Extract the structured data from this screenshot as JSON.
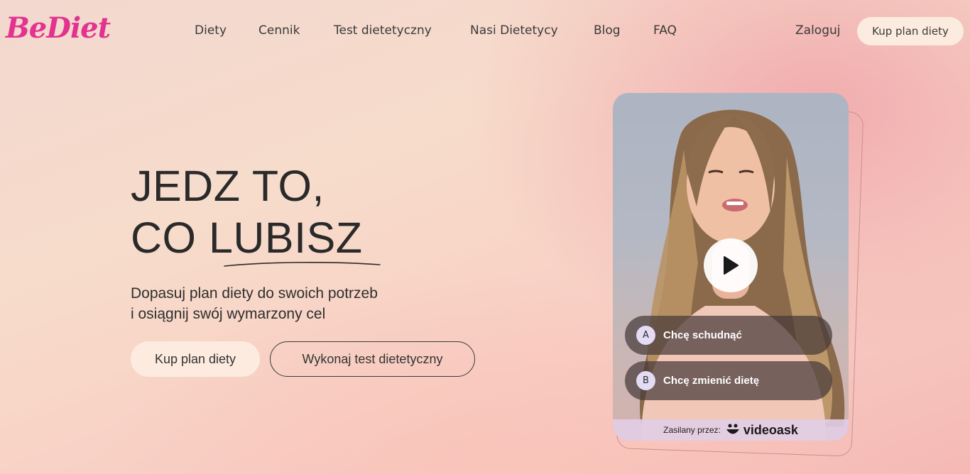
{
  "header": {
    "logo": "BeDiet",
    "nav": [
      "Diety",
      "Cennik",
      "Test dietetyczny",
      "Nasi Dietetycy",
      "Blog",
      "FAQ"
    ],
    "login": "Zaloguj",
    "cta": "Kup plan diety"
  },
  "hero": {
    "title_line1": "JEDZ TO,",
    "title_line2_prefix": "CO ",
    "title_line2_emphasis": "LUBISZ",
    "subtitle_line1": "Dopasuj plan diety do swoich potrzeb",
    "subtitle_line2": "i osiągnij swój wymarzony cel",
    "primary_button": "Kup plan diety",
    "secondary_button": "Wykonaj test dietetyczny"
  },
  "video": {
    "options": [
      {
        "letter": "A",
        "label": "Chcę schudnąć"
      },
      {
        "letter": "B",
        "label": "Chcę zmienić dietę"
      }
    ],
    "powered_by": "Zasilany przez:",
    "powered_brand": "videoask"
  },
  "colors": {
    "brand": "#e2338f",
    "button_fill": "#fdebdf"
  }
}
